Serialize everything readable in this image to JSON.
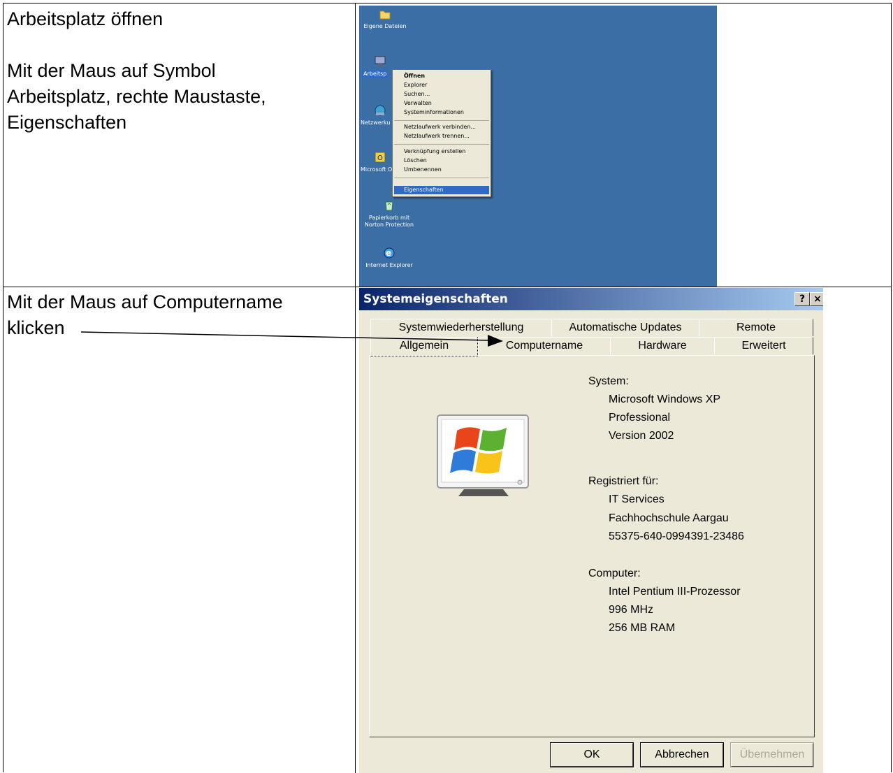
{
  "instructions": {
    "step1_title": "Arbeitsplatz öffnen",
    "step1_line1": "Mit der Maus auf Symbol",
    "step1_line2": "Arbeitsplatz, rechte Maustaste,",
    "step1_line3": "Eigenschaften",
    "step2_line1": "Mit der Maus auf Computername",
    "step2_line2": "klicken"
  },
  "desktop": {
    "background_color": "#3a6ea5",
    "icons": [
      {
        "label": "Eigene Dateien",
        "icon": "folder-icon"
      },
      {
        "label": "Arbeitsp",
        "icon": "my-computer-icon"
      },
      {
        "label": "Netzwerku",
        "icon": "network-icon"
      },
      {
        "label": "Microsoft O",
        "icon": "outlook-icon"
      },
      {
        "label": "Papierkorb mit",
        "label2": "Norton Protection",
        "icon": "recycle-bin-icon"
      },
      {
        "label": "Internet Explorer",
        "icon": "internet-explorer-icon"
      }
    ],
    "context_menu": {
      "items": [
        "Öffnen",
        "Explorer",
        "Suchen...",
        "Verwalten",
        "Systeminformationen",
        "Netzlaufwerk verbinden...",
        "Netzlaufwerk trennen...",
        "Verknüpfung erstellen",
        "Löschen",
        "Umbenennen",
        "Eigenschaften"
      ],
      "highlighted": "Eigenschaften"
    }
  },
  "dialog": {
    "title": "Systemeigenschaften",
    "help_button": "?",
    "close_button": "×",
    "tabs_row1": [
      "Systemwiederherstellung",
      "Automatische Updates",
      "Remote"
    ],
    "tabs_row2": [
      "Allgemein",
      "Computername",
      "Hardware",
      "Erweitert"
    ],
    "active_tab": "Allgemein",
    "system_label": "System:",
    "system_lines": [
      "Microsoft Windows XP",
      "Professional",
      "Version 2002"
    ],
    "registered_label": "Registriert für:",
    "registered_lines": [
      "IT Services",
      "Fachhochschule Aargau",
      "55375-640-0994391-23486"
    ],
    "computer_label": "Computer:",
    "computer_lines": [
      "Intel Pentium III-Prozessor",
      "996 MHz",
      "256 MB RAM"
    ],
    "buttons": {
      "ok": "OK",
      "cancel": "Abbrechen",
      "apply": "Übernehmen"
    }
  }
}
